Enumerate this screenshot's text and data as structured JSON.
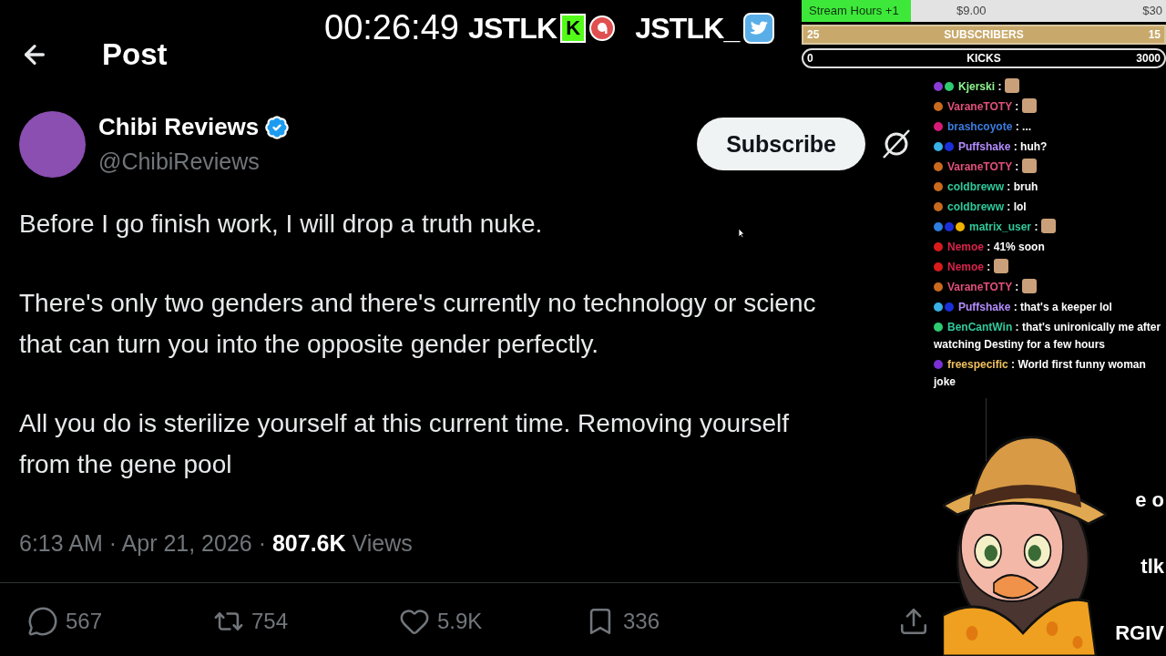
{
  "overlay": {
    "timer": "00:26:49",
    "logos": [
      {
        "kind": "kick",
        "name": "JSTLK",
        "mark": "K"
      },
      {
        "kind": "twitter",
        "name": "JSTLK_"
      }
    ]
  },
  "goals": [
    {
      "kind": "money",
      "label": "Stream Hours +1",
      "current": "$9.00",
      "target": "$30",
      "level": 0.3
    },
    {
      "kind": "gold",
      "start": "25",
      "label": "SUBSCRIBERS",
      "end": "15",
      "level": 1
    },
    {
      "kind": "dark",
      "start": "0",
      "label": "KICKS",
      "end": "3000"
    }
  ],
  "header": {
    "title": "Post"
  },
  "post": {
    "author": "Chibi Reviews",
    "verified": true,
    "handle": "@ChibiReviews",
    "subscribe_button": "Subscribe",
    "paragraphs": [
      [
        "Before I go finish work, I will drop a truth nuke."
      ],
      [
        "There's only two genders and there's currently no technology or scienc",
        "that can turn you into the opposite gender perfectly."
      ],
      [
        "All you do is sterilize yourself at this current time. Removing yourself",
        "from the gene pool"
      ]
    ],
    "time": "6:13 AM · Apr 21, 2026 · ",
    "views_count": "807.6K",
    "views_label": " Views",
    "actions": [
      {
        "kind": "reply",
        "count": "567"
      },
      {
        "kind": "repost",
        "count": "754"
      },
      {
        "kind": "like",
        "count": "5.9K"
      },
      {
        "kind": "bookmark",
        "count": "336"
      },
      {
        "kind": "share"
      }
    ]
  },
  "chat": [
    {
      "user": "Kjerski",
      "color": "#8ef58e",
      "badges": [
        {
          "color": "#8b3dd6"
        },
        {
          "color": "#2ecc71"
        }
      ],
      "separator": ":",
      "kind": "emote"
    },
    {
      "user": "VaraneTOTY",
      "color": "#e0507a",
      "badges": [
        {
          "color": "#c96a1e"
        }
      ],
      "separator": ":",
      "kind": "emote"
    },
    {
      "user": "brashcoyote",
      "color": "#3b7de0",
      "badges": [
        {
          "color": "#d81b78"
        }
      ],
      "separator": ":",
      "kind": "text",
      "text": "..."
    },
    {
      "user": "Puffshake",
      "color": "#b48cff",
      "badges": [
        {
          "color": "#3ab0e8"
        },
        {
          "color": "#1a2fd9"
        }
      ],
      "separator": ":",
      "kind": "text",
      "text": "huh?"
    },
    {
      "user": "VaraneTOTY",
      "color": "#e0507a",
      "badges": [
        {
          "color": "#c96a1e"
        }
      ],
      "separator": ":",
      "kind": "emote"
    },
    {
      "user": "coldbreww",
      "color": "#2fc99a",
      "badges": [
        {
          "color": "#c96a1e"
        }
      ],
      "separator": ":",
      "kind": "text",
      "text": "bruh"
    },
    {
      "user": "coldbreww",
      "color": "#2fc99a",
      "badges": [
        {
          "color": "#c96a1e"
        }
      ],
      "separator": ":",
      "kind": "text",
      "text": "lol"
    },
    {
      "user": "matrix_user",
      "color": "#2fc99a",
      "badges": [
        {
          "color": "#2d7fe0"
        },
        {
          "color": "#1a2fd9"
        },
        {
          "color": "#f0b400"
        }
      ],
      "separator": ":",
      "kind": "emote"
    },
    {
      "user": "Nemoe",
      "color": "#d8234a",
      "badges": [
        {
          "color": "#d81b1b"
        }
      ],
      "separator": ":",
      "kind": "text",
      "text": "41% soon"
    },
    {
      "user": "Nemoe",
      "color": "#d8234a",
      "badges": [
        {
          "color": "#d81b1b"
        }
      ],
      "separator": ":",
      "kind": "emote"
    },
    {
      "user": "VaraneTOTY",
      "color": "#e0507a",
      "badges": [
        {
          "color": "#c96a1e"
        }
      ],
      "separator": ":",
      "kind": "emote"
    },
    {
      "user": "Puffshake",
      "color": "#b48cff",
      "badges": [
        {
          "color": "#3ab0e8"
        },
        {
          "color": "#1a2fd9"
        }
      ],
      "separator": ":",
      "kind": "text",
      "text": "that's a keeper lol"
    },
    {
      "user": "BenCantWin",
      "color": "#2fc99a",
      "badges": [
        {
          "color": "#2ecc71"
        }
      ],
      "separator": ":",
      "kind": "text",
      "text": "that's unironically me after watching Destiny for a few hours"
    },
    {
      "user": "freespecific",
      "color": "#f0c060",
      "badges": [
        {
          "color": "#7b2fd6"
        }
      ],
      "separator": ":",
      "kind": "text",
      "text": "World first funny woman joke"
    }
  ],
  "side_fragments": [
    "e o",
    "tlk",
    "RGIV"
  ]
}
